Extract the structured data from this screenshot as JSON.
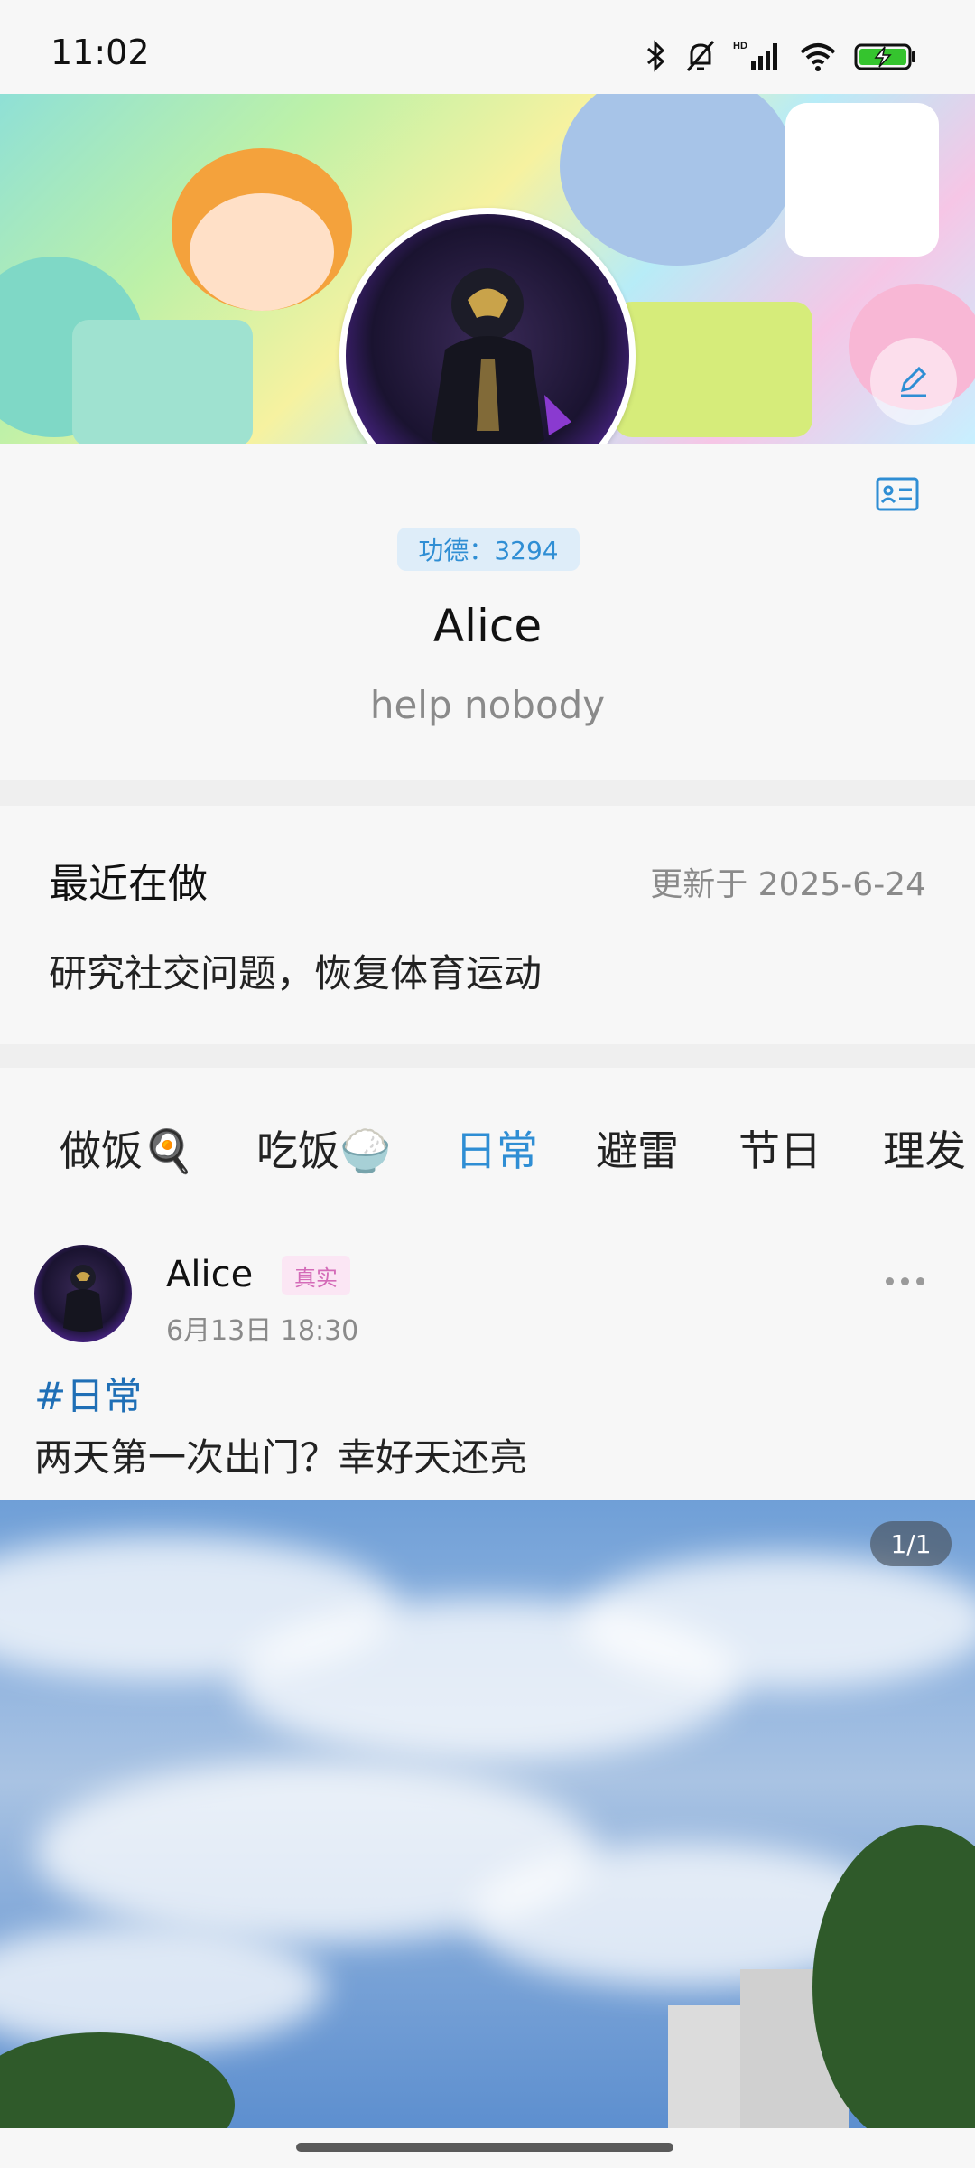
{
  "status_bar": {
    "time": "11:02",
    "icons": [
      "bluetooth-icon",
      "bell-muted-icon",
      "hd-signal-icon",
      "wifi-icon",
      "battery-charging-icon"
    ]
  },
  "profile": {
    "merit": "功德：3294",
    "name": "Alice",
    "bio": "help nobody"
  },
  "recent": {
    "title": "最近在做",
    "updated": "更新于 2025-6-24",
    "text": "研究社交问题，恢复体育运动"
  },
  "tabs": [
    {
      "label": "做饭🍳"
    },
    {
      "label": "吃饭🍚"
    },
    {
      "label": "日常",
      "active": true
    },
    {
      "label": "避雷"
    },
    {
      "label": "节日"
    },
    {
      "label": "理发💈"
    }
  ],
  "post": {
    "author": "Alice",
    "badge": "真实",
    "time": "6月13日 18:30",
    "tag": "#日常",
    "text": "两天第一次出门？幸好天还亮",
    "photo_counter": "1/1"
  },
  "colors": {
    "accent": "#2f8ed4",
    "tag_blue": "#1f6fb6",
    "badge_pink": "#d46bb8"
  }
}
